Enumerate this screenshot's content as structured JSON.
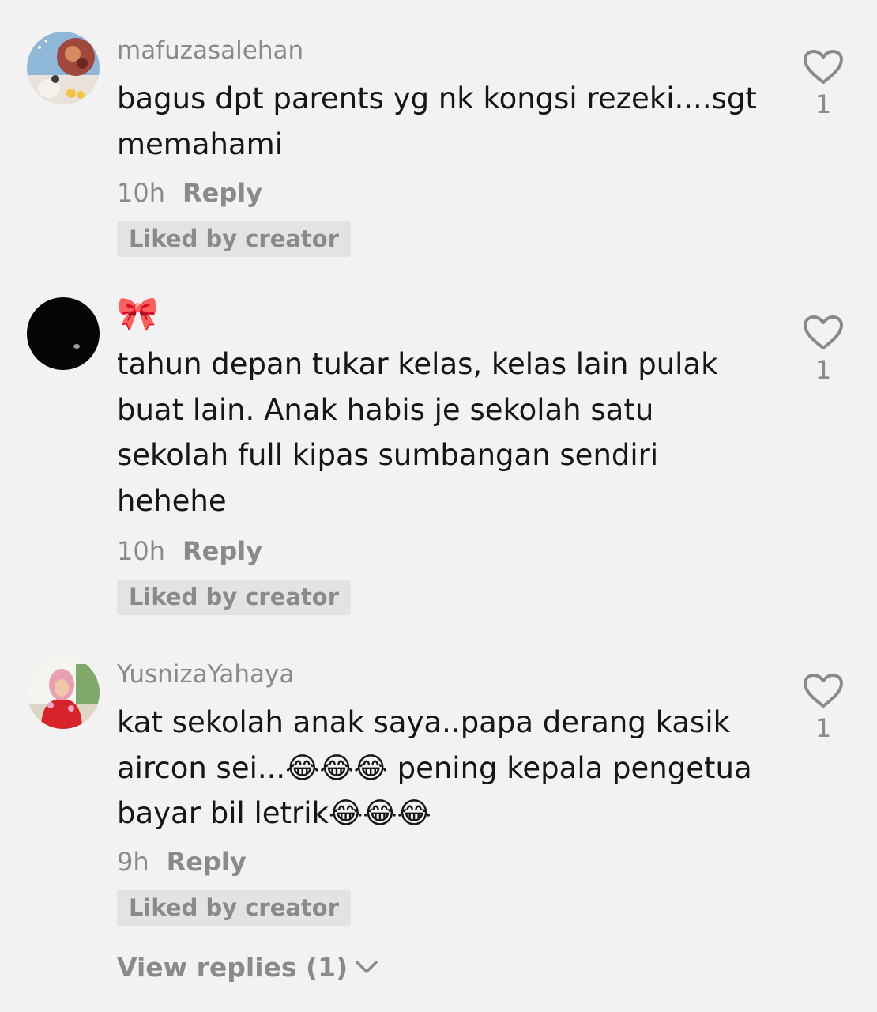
{
  "comments": [
    {
      "username": "mafuzasalehan",
      "text": "bagus dpt parents yg nk kongsi rezeki....sgt memahami",
      "time": "10h",
      "reply_label": "Reply",
      "badge": "Liked by creator",
      "likes": "1"
    },
    {
      "username": "🎀",
      "text": "tahun depan tukar kelas, kelas lain pulak buat lain. Anak habis je sekolah satu sekolah full kipas sumbangan sendiri hehehe",
      "time": "10h",
      "reply_label": "Reply",
      "badge": "Liked by creator",
      "likes": "1"
    },
    {
      "username": "YusnizaYahaya",
      "text": "kat sekolah anak saya..papa derang kasik aircon sei...😂😂😂 pening kepala pengetua bayar bil letrik😂😂😂",
      "time": "9h",
      "reply_label": "Reply",
      "badge": "Liked by creator",
      "likes": "1"
    }
  ],
  "view_replies_label": "View replies (1)",
  "icons": {
    "like": "heart-outline-icon",
    "expand": "chevron-down-icon"
  },
  "colors": {
    "background": "#f2f2f2",
    "text": "#161616",
    "muted": "#8a8a8a",
    "badge_bg": "#e3e3e3"
  }
}
